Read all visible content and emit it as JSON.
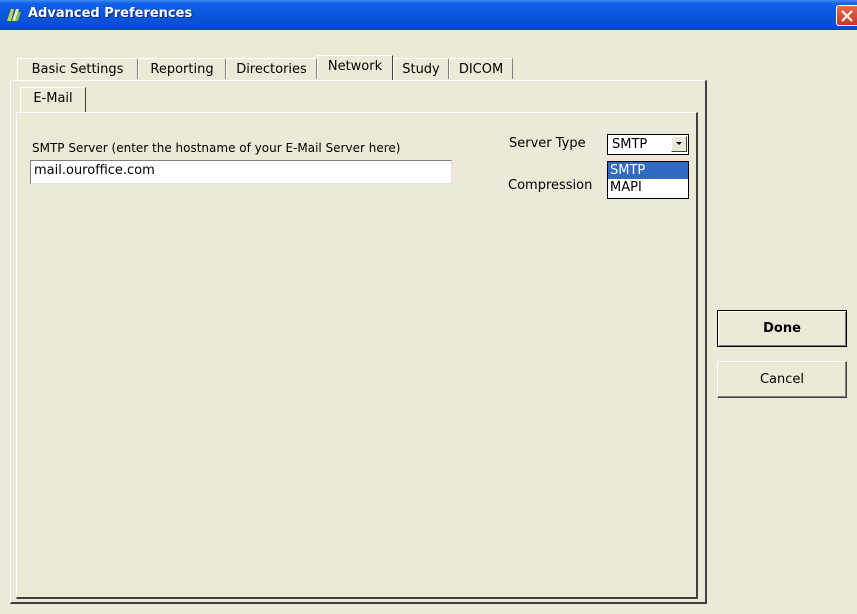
{
  "window": {
    "title": "Advanced Preferences"
  },
  "tabs": [
    {
      "label": "Basic Settings",
      "active": false
    },
    {
      "label": "Reporting",
      "active": false
    },
    {
      "label": "Directories",
      "active": false
    },
    {
      "label": "Network",
      "active": true
    },
    {
      "label": "Study",
      "active": false
    },
    {
      "label": "DICOM",
      "active": false
    }
  ],
  "subtabs": [
    {
      "label": "E-Mail",
      "active": true
    }
  ],
  "email": {
    "smtp_label": "SMTP Server (enter the hostname of your E-Mail Server here)",
    "smtp_value": "mail.ouroffice.com",
    "server_type_label": "Server Type",
    "server_type_value": "SMTP",
    "server_type_options": [
      "SMTP",
      "MAPI"
    ],
    "compression_label": "Compression"
  },
  "buttons": {
    "done": "Done",
    "cancel": "Cancel"
  },
  "colors": {
    "titlebar": "#0a55dc",
    "dialog_bg": "#ece9d8",
    "selection": "#316ac5",
    "close_button": "#d2472a"
  }
}
